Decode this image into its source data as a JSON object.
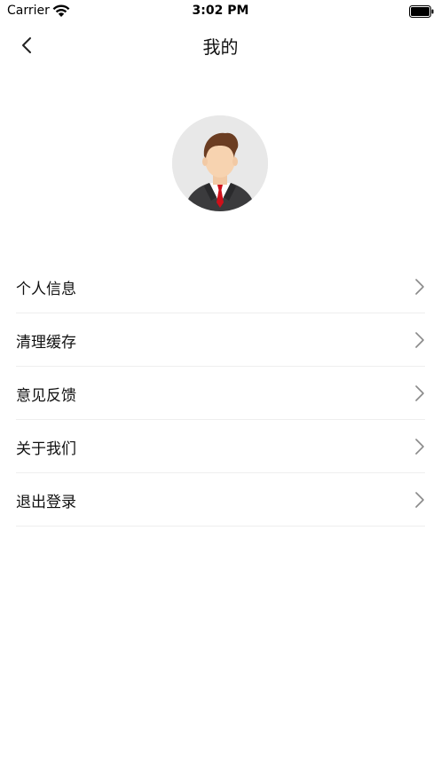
{
  "status_bar": {
    "carrier": "Carrier",
    "time": "3:02 PM",
    "wifi_icon": "wifi-icon",
    "battery_icon": "battery-icon"
  },
  "nav": {
    "title": "我的",
    "back_icon": "chevron-left-icon"
  },
  "avatar": {
    "icon": "user-avatar"
  },
  "menu": {
    "items": [
      {
        "label": "个人信息"
      },
      {
        "label": "清理缓存"
      },
      {
        "label": "意见反馈"
      },
      {
        "label": "关于我们"
      },
      {
        "label": "退出登录"
      }
    ],
    "chevron_icon": "chevron-right-icon"
  },
  "colors": {
    "background": "#ffffff",
    "text": "#111111",
    "divider": "#eeeeee",
    "chevron": "#8a8a8a",
    "avatar_bg": "#e8e8e8",
    "tie": "#d0101a"
  }
}
